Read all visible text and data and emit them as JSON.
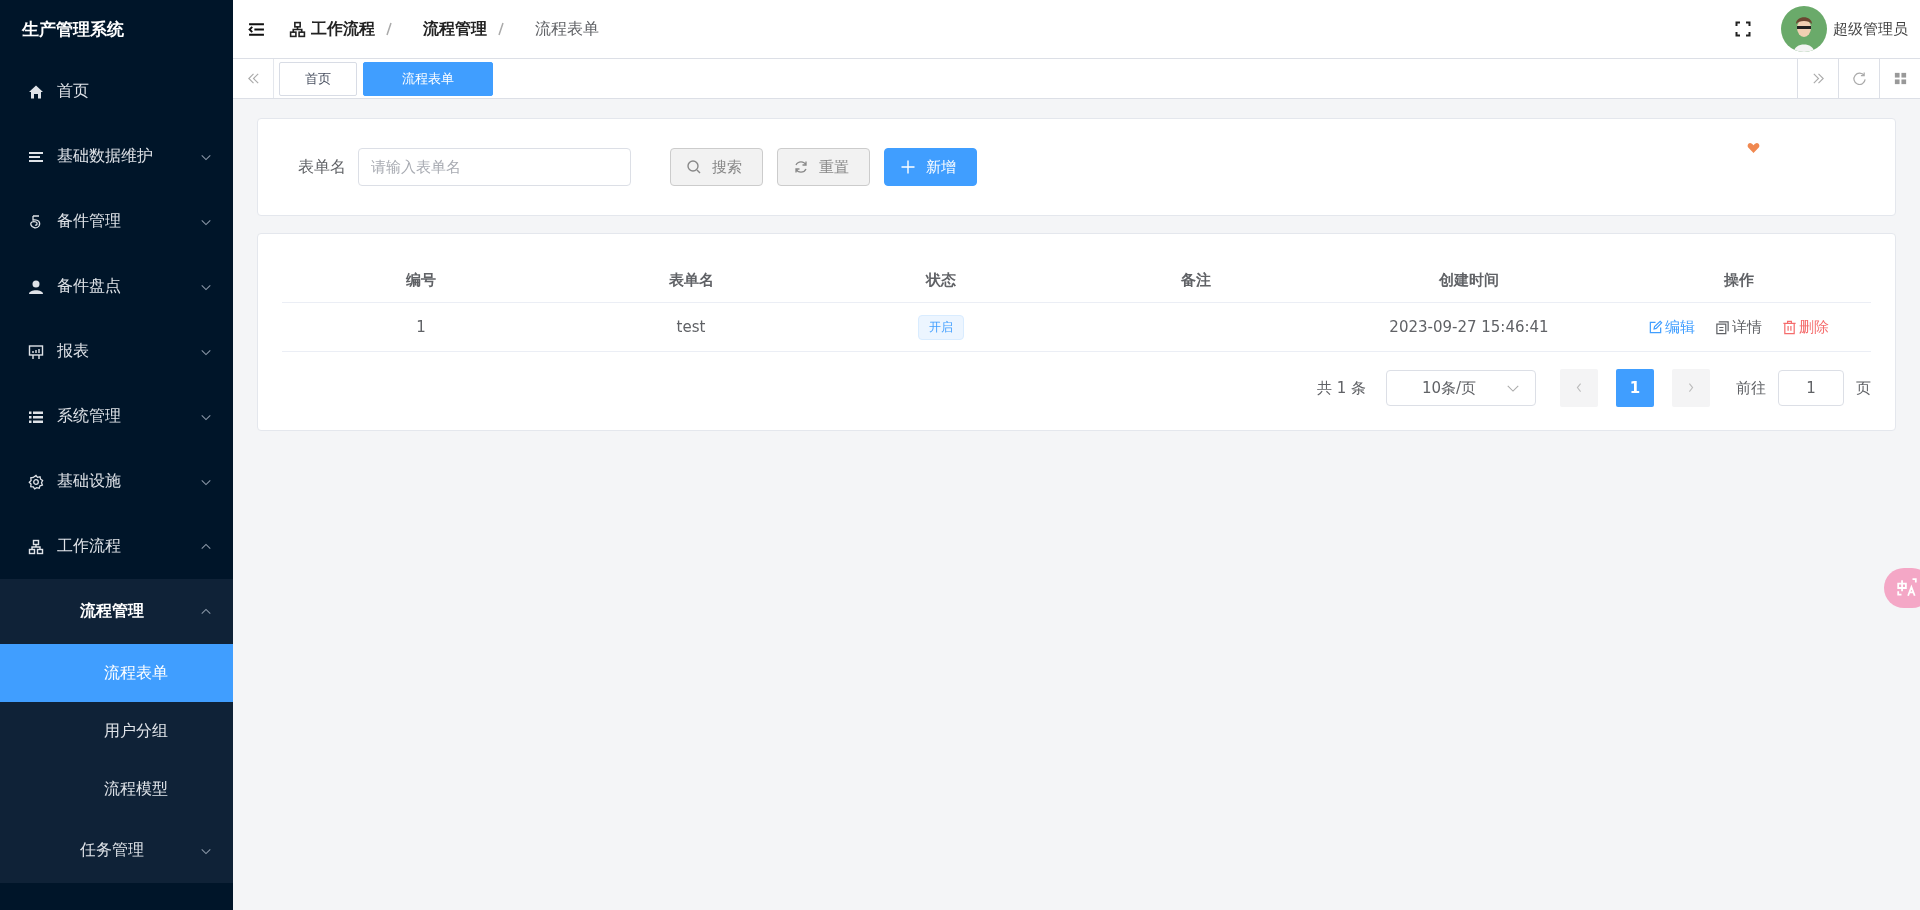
{
  "sidebar": {
    "title": "生产管理系统",
    "items": [
      {
        "label": "首页",
        "kind": "home",
        "selected": false
      },
      {
        "label": "基础数据维护",
        "kind": "lines",
        "expanded": false,
        "selected": false
      },
      {
        "label": "备件管理",
        "kind": "spiral",
        "expanded": false,
        "selected": false
      },
      {
        "label": "备件盘点",
        "kind": "user",
        "expanded": false,
        "selected": false
      },
      {
        "label": "报表",
        "kind": "board",
        "expanded": false,
        "selected": false
      },
      {
        "label": "系统管理",
        "kind": "list",
        "expanded": false,
        "selected": false
      },
      {
        "label": "基础设施",
        "kind": "gear",
        "expanded": false,
        "selected": false
      },
      {
        "label": "工作流程",
        "kind": "tree",
        "expanded": true,
        "selected": false,
        "children": [
          {
            "label": "流程管理",
            "expanded": true,
            "selected": false,
            "children": [
              {
                "label": "流程表单",
                "selected": true
              },
              {
                "label": "用户分组",
                "selected": false
              },
              {
                "label": "流程模型",
                "selected": false
              }
            ]
          },
          {
            "label": "任务管理",
            "expanded": false,
            "selected": false
          }
        ]
      }
    ]
  },
  "breadcrumb": [
    {
      "label": "工作流程",
      "icon": true
    },
    {
      "label": "流程管理",
      "icon": false
    },
    {
      "label": "流程表单",
      "icon": false
    }
  ],
  "user": {
    "name": "超级管理员"
  },
  "tabs": [
    {
      "label": "首页",
      "selected": false
    },
    {
      "label": "流程表单",
      "selected": true
    }
  ],
  "search": {
    "label": "表单名",
    "placeholder": "请输入表单名",
    "buttons": [
      {
        "label": "搜索",
        "kind": "search"
      },
      {
        "label": "重置",
        "kind": "reset"
      },
      {
        "label": "新增",
        "kind": "add"
      }
    ]
  },
  "table": {
    "columns": [
      "编号",
      "表单名",
      "状态",
      "备注",
      "创建时间",
      "操作"
    ],
    "rows": [
      {
        "id": "1",
        "name": "test",
        "status": "开启",
        "created": "2023-09-27 15:46:41",
        "actions": [
          {
            "label": "编辑",
            "kind": "edit"
          },
          {
            "label": "详情",
            "kind": "detail"
          },
          {
            "label": "删除",
            "kind": "delete"
          }
        ]
      }
    ]
  },
  "pagination": {
    "total": "共 1 条",
    "page_size": "10条/页",
    "pages": [
      {
        "label": "1",
        "selected": true
      }
    ],
    "goto_label": "前往",
    "goto_value": "1",
    "goto_suffix": "页"
  }
}
